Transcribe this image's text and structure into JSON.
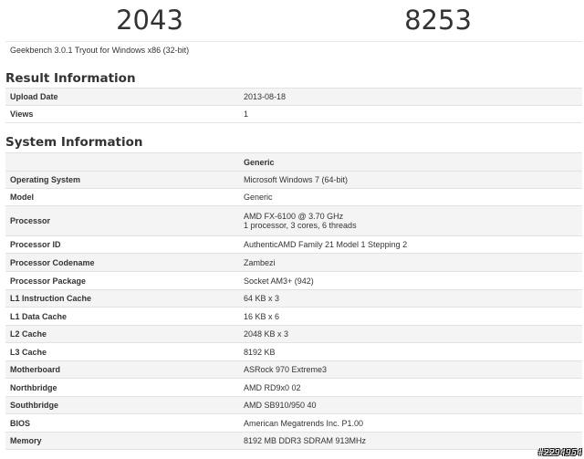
{
  "scores": {
    "single_core": "2043",
    "multi_core": "8253"
  },
  "version": "Geekbench 3.0.1 Tryout for Windows x86 (32-bit)",
  "result_section": {
    "title": "Result Information",
    "rows": [
      {
        "label": "Upload Date",
        "value": "2013-08-18"
      },
      {
        "label": "Views",
        "value": "1"
      }
    ]
  },
  "system_section": {
    "title": "System Information",
    "header_value": "Generic",
    "rows": [
      {
        "label": "Operating System",
        "value": "Microsoft Windows 7 (64-bit)"
      },
      {
        "label": "Model",
        "value": "Generic"
      },
      {
        "label": "Processor",
        "value": "AMD FX-6100 @ 3.70 GHz",
        "value2": "1 processor, 3 cores, 6 threads"
      },
      {
        "label": "Processor ID",
        "value": "AuthenticAMD Family 21 Model 1 Stepping 2"
      },
      {
        "label": "Processor Codename",
        "value": "Zambezi"
      },
      {
        "label": "Processor Package",
        "value": "Socket AM3+ (942)"
      },
      {
        "label": "L1 Instruction Cache",
        "value": "64 KB x 3"
      },
      {
        "label": "L1 Data Cache",
        "value": "16 KB x 6"
      },
      {
        "label": "L2 Cache",
        "value": "2048 KB x 3"
      },
      {
        "label": "L3 Cache",
        "value": "8192 KB"
      },
      {
        "label": "Motherboard",
        "value": "ASRock 970 Extreme3"
      },
      {
        "label": "Northbridge",
        "value": "AMD RD9x0 02"
      },
      {
        "label": "Southbridge",
        "value": "AMD SB910/950 40"
      },
      {
        "label": "BIOS",
        "value": "American Megatrends Inc. P1.00"
      },
      {
        "label": "Memory",
        "value": "8192 MB DDR3 SDRAM 913MHz"
      }
    ]
  },
  "watermark": "#2294954"
}
